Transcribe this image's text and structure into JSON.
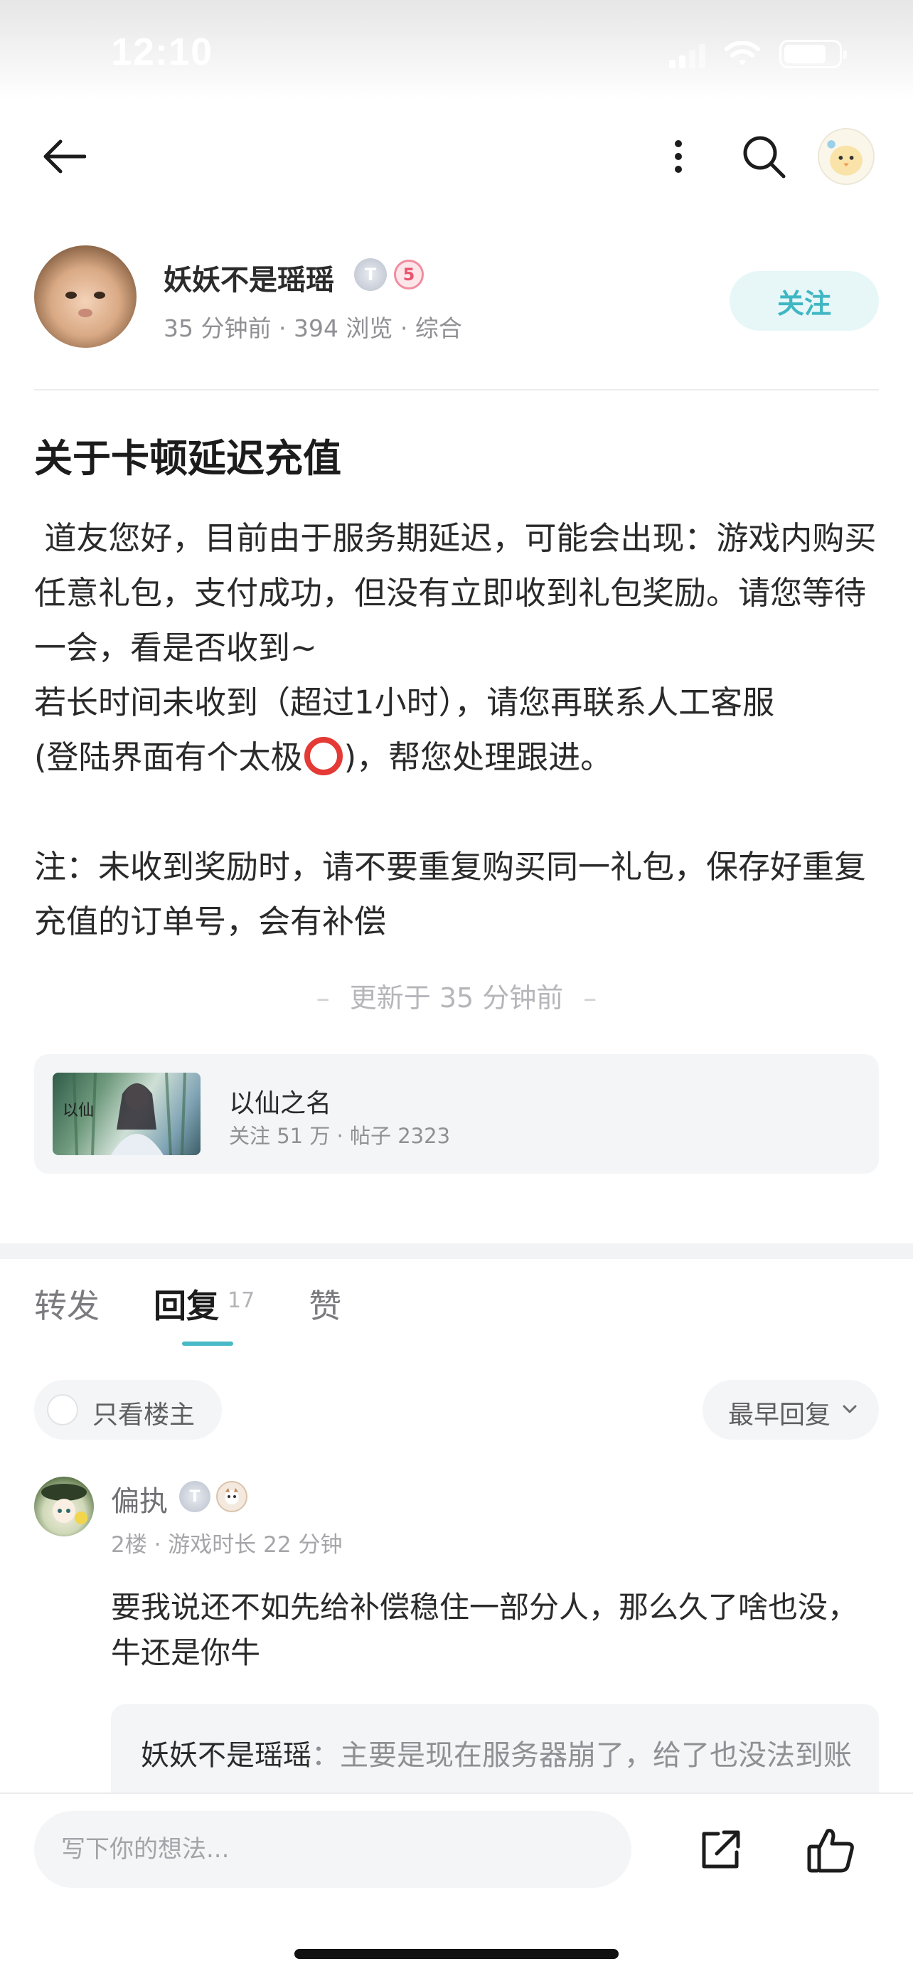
{
  "status_bar": {
    "time": "12:10"
  },
  "nav": {
    "back_icon": "back-arrow-icon",
    "more_icon": "more-vertical-icon",
    "search_icon": "search-icon",
    "user_avatar": "chick-avatar"
  },
  "author": {
    "name": "妖妖不是瑶瑶",
    "badge_t": "T",
    "badge_level": "5",
    "meta": "35 分钟前 · 394 浏览 · 综合",
    "follow_label": "关注"
  },
  "post": {
    "title": "关于卡顿延迟充值",
    "paragraphs": [
      " 道友您好，目前由于服务期延迟，可能会出现：游戏内购买任意礼包，支付成功，但没有立即收到礼包奖励。请您等待一会，看是否收到~",
      "若长时间未收到（超过1小时），请您再联系人工客服",
      "(登陆界面有个太极",
      ")，帮您处理跟进。",
      "",
      "注：未收到奖励时，请不要重复购买同一礼包，保存好重复充值的订单号，会有补偿"
    ],
    "updated": "更新于 35 分钟前"
  },
  "forum": {
    "name": "以仙之名",
    "meta": "关注 51 万 · 帖子 2323"
  },
  "tabs": {
    "repost": "转发",
    "reply": "回复",
    "reply_count": "17",
    "like": "赞"
  },
  "filters": {
    "only_op": "只看楼主",
    "sort": "最早回复"
  },
  "reply": {
    "name": "偏执",
    "badge_t": "T",
    "meta": "2楼 · 游戏时长 22 分钟",
    "text": "要我说还不如先给补偿稳住一部分人，那么久了啥也没，牛还是你牛",
    "quote_author": "妖妖不是瑶瑶",
    "quote_text": "：主要是现在服务器崩了，给了也没法到账"
  },
  "bottom_bar": {
    "input_placeholder": "写下你的想法...",
    "share_icon": "share-icon",
    "like_icon": "thumbs-up-icon"
  },
  "colors": {
    "accent": "#48b9c6",
    "follow_bg": "#e7f7f8",
    "emoji_red": "#e53935"
  }
}
